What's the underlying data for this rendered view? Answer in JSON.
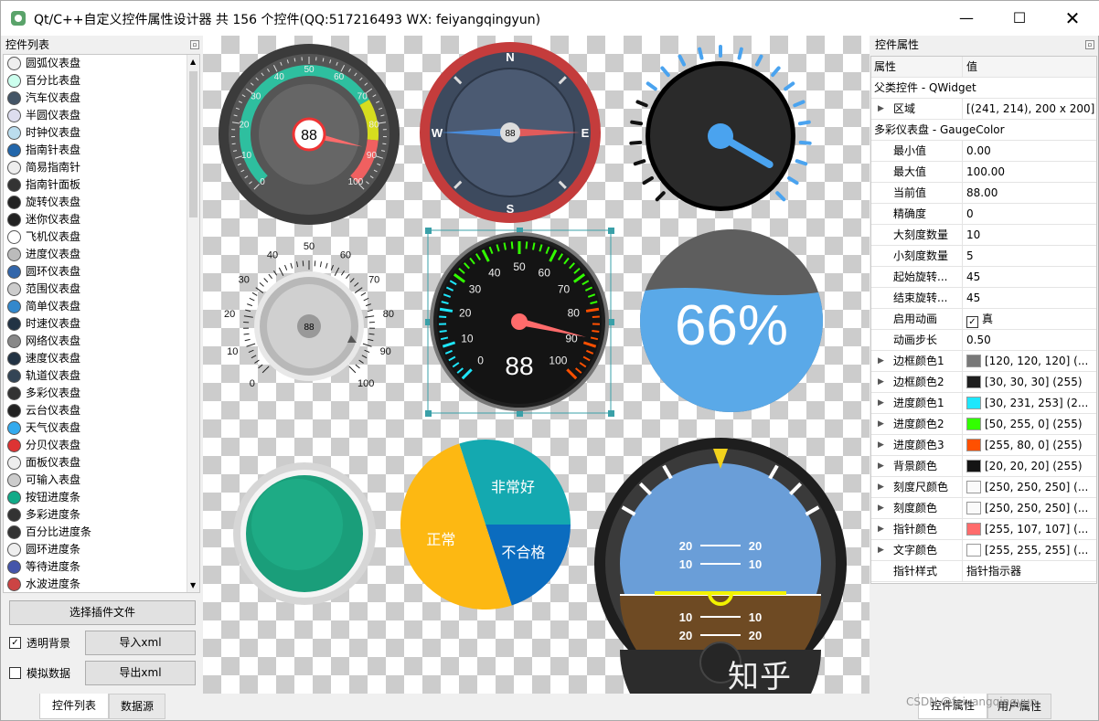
{
  "window": {
    "title": "Qt/C++自定义控件属性设计器 共 156 个控件(QQ:517216493 WX: feiyangqingyun)"
  },
  "left_panel": {
    "header": "控件列表",
    "items": [
      "圆弧仪表盘",
      "百分比表盘",
      "汽车仪表盘",
      "半圆仪表盘",
      "时钟仪表盘",
      "指南针表盘",
      "简易指南针",
      "指南针面板",
      "旋转仪表盘",
      "迷你仪表盘",
      "飞机仪表盘",
      "进度仪表盘",
      "圆环仪表盘",
      "范围仪表盘",
      "简单仪表盘",
      "时速仪表盘",
      "网络仪表盘",
      "速度仪表盘",
      "轨道仪表盘",
      "多彩仪表盘",
      "云台仪表盘",
      "天气仪表盘",
      "分贝仪表盘",
      "面板仪表盘",
      "可输入表盘",
      "按钮进度条",
      "多彩进度条",
      "百分比进度条",
      "圆环进度条",
      "等待进度条",
      "水波进度条"
    ],
    "select_plugin": "选择插件文件",
    "transparent_bg": "透明背景",
    "import_xml": "导入xml",
    "simulate_data": "模拟数据",
    "export_xml": "导出xml",
    "tabs": [
      "控件列表",
      "数据源"
    ]
  },
  "canvas": {
    "arc_gauge": {
      "value": "88",
      "ticks": [
        "0",
        "10",
        "20",
        "30",
        "40",
        "50",
        "60",
        "70",
        "80",
        "90",
        "100"
      ]
    },
    "compass": {
      "value": "88",
      "n": "N",
      "s": "S",
      "e": "E",
      "w": "W"
    },
    "knob": {
      "value": "88",
      "ticks": [
        "0",
        "10",
        "20",
        "30",
        "40",
        "50",
        "60",
        "70",
        "80",
        "90",
        "100"
      ]
    },
    "color_gauge": {
      "value": "88",
      "ticks": [
        "0",
        "10",
        "20",
        "30",
        "40",
        "50",
        "60",
        "70",
        "80",
        "90",
        "100"
      ]
    },
    "wave": {
      "text": "66%",
      "level": 0.66
    },
    "pie": {
      "slices": [
        {
          "label": "非常好",
          "percent": 0.3,
          "color": "#14a9b0"
        },
        {
          "label": "不合格",
          "percent": 0.2,
          "color": "#0b6cbf"
        },
        {
          "label": "正常",
          "percent": 0.5,
          "color": "#fdb812"
        }
      ]
    },
    "attitude": {
      "marks": [
        "20",
        "10",
        "10",
        "20"
      ]
    }
  },
  "right_panel": {
    "header": "控件属性",
    "col_prop": "属性",
    "col_value": "值",
    "rows": [
      {
        "type": "group",
        "k": "父类控件 - QWidget"
      },
      {
        "type": "row",
        "k": "区域",
        "v": "[(241, 214), 200 x 200]",
        "expand": true
      },
      {
        "type": "group",
        "k": "多彩仪表盘 - GaugeColor"
      },
      {
        "type": "row",
        "k": "最小值",
        "v": "0.00"
      },
      {
        "type": "row",
        "k": "最大值",
        "v": "100.00"
      },
      {
        "type": "row",
        "k": "当前值",
        "v": "88.00"
      },
      {
        "type": "row",
        "k": "精确度",
        "v": "0"
      },
      {
        "type": "row",
        "k": "大刻度数量",
        "v": "10"
      },
      {
        "type": "row",
        "k": "小刻度数量",
        "v": "5"
      },
      {
        "type": "row",
        "k": "起始旋转...",
        "v": "45"
      },
      {
        "type": "row",
        "k": "结束旋转...",
        "v": "45"
      },
      {
        "type": "check",
        "k": "启用动画",
        "v": "真"
      },
      {
        "type": "row",
        "k": "动画步长",
        "v": "0.50"
      },
      {
        "type": "color",
        "k": "边框颜色1",
        "v": "[120, 120, 120] (...",
        "color": "#787878",
        "expand": true
      },
      {
        "type": "color",
        "k": "边框颜色2",
        "v": "[30, 30, 30] (255)",
        "color": "#1e1e1e",
        "expand": true
      },
      {
        "type": "color",
        "k": "进度颜色1",
        "v": "[30, 231, 253] (2...",
        "color": "#1ee7fd",
        "expand": true
      },
      {
        "type": "color",
        "k": "进度颜色2",
        "v": "[50, 255, 0] (255)",
        "color": "#32ff00",
        "expand": true
      },
      {
        "type": "color",
        "k": "进度颜色3",
        "v": "[255, 80, 0] (255)",
        "color": "#ff5000",
        "expand": true
      },
      {
        "type": "color",
        "k": "背景颜色",
        "v": "[20, 20, 20] (255)",
        "color": "#141414",
        "expand": true
      },
      {
        "type": "color",
        "k": "刻度尺颜色",
        "v": "[250, 250, 250] (...",
        "color": "#fafafa",
        "expand": true
      },
      {
        "type": "color",
        "k": "刻度颜色",
        "v": "[250, 250, 250] (...",
        "color": "#fafafa",
        "expand": true
      },
      {
        "type": "color",
        "k": "指针颜色",
        "v": "[255, 107, 107] (...",
        "color": "#ff6b6b",
        "expand": true
      },
      {
        "type": "color",
        "k": "文字颜色",
        "v": "[255, 255, 255] (...",
        "color": "#ffffff",
        "expand": true
      },
      {
        "type": "row",
        "k": "指针样式",
        "v": "指针指示器"
      }
    ],
    "tabs": [
      "控件属性",
      "用户属性"
    ]
  },
  "watermark": "知乎 @feiyangqingyun",
  "csdn": "CSDN @feiyangqingyun"
}
